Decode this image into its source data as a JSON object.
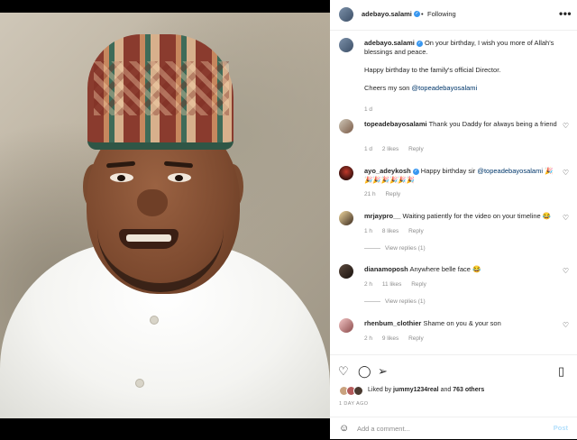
{
  "header": {
    "username": "adebayo.salami",
    "following_label": "Following",
    "separator": "•",
    "more_label": "•••"
  },
  "caption": {
    "username": "adebayo.salami",
    "line1": "On your birthday, I wish you more of Allah's blessings and peace.",
    "line2": "Happy birthday to the family's official Director.",
    "line3_prefix": "Cheers my son ",
    "line3_mention": "@topeadebayosalami",
    "time": "1 d"
  },
  "comments": [
    {
      "username": "topeadebayosalami",
      "text": "Thank you Daddy for always being a friend",
      "time": "1 d",
      "likes": "2 likes",
      "reply": "Reply"
    },
    {
      "username": "ayo_adeykosh",
      "verified": true,
      "text_prefix": "Happy birthday sir ",
      "mention": "@topeadebayosalami",
      "text_suffix": " 🎉🎉🎉🎉🎉🎉🎉",
      "time": "21 h",
      "reply": "Reply"
    },
    {
      "username": "mrjaypro__",
      "text": "Waiting patiently for the video on your timeline 😂",
      "time": "1 h",
      "likes": "8 likes",
      "reply": "Reply",
      "view_replies": "View replies (1)"
    },
    {
      "username": "dianamoposh",
      "text": "Anywhere belle face 😂",
      "time": "2 h",
      "likes": "11 likes",
      "reply": "Reply",
      "view_replies": "View replies (1)"
    },
    {
      "username": "rhenbum_clothier",
      "text": "Shame on you & your son",
      "time": "2 h",
      "likes": "9 likes",
      "reply": "Reply"
    }
  ],
  "actions": {
    "liked_prefix": "Liked by ",
    "liked_user": "jummy1234real",
    "liked_mid": " and ",
    "liked_count": "763 others",
    "time_ago": "1 DAY AGO"
  },
  "add_comment": {
    "placeholder": "Add a comment...",
    "post_label": "Post"
  }
}
